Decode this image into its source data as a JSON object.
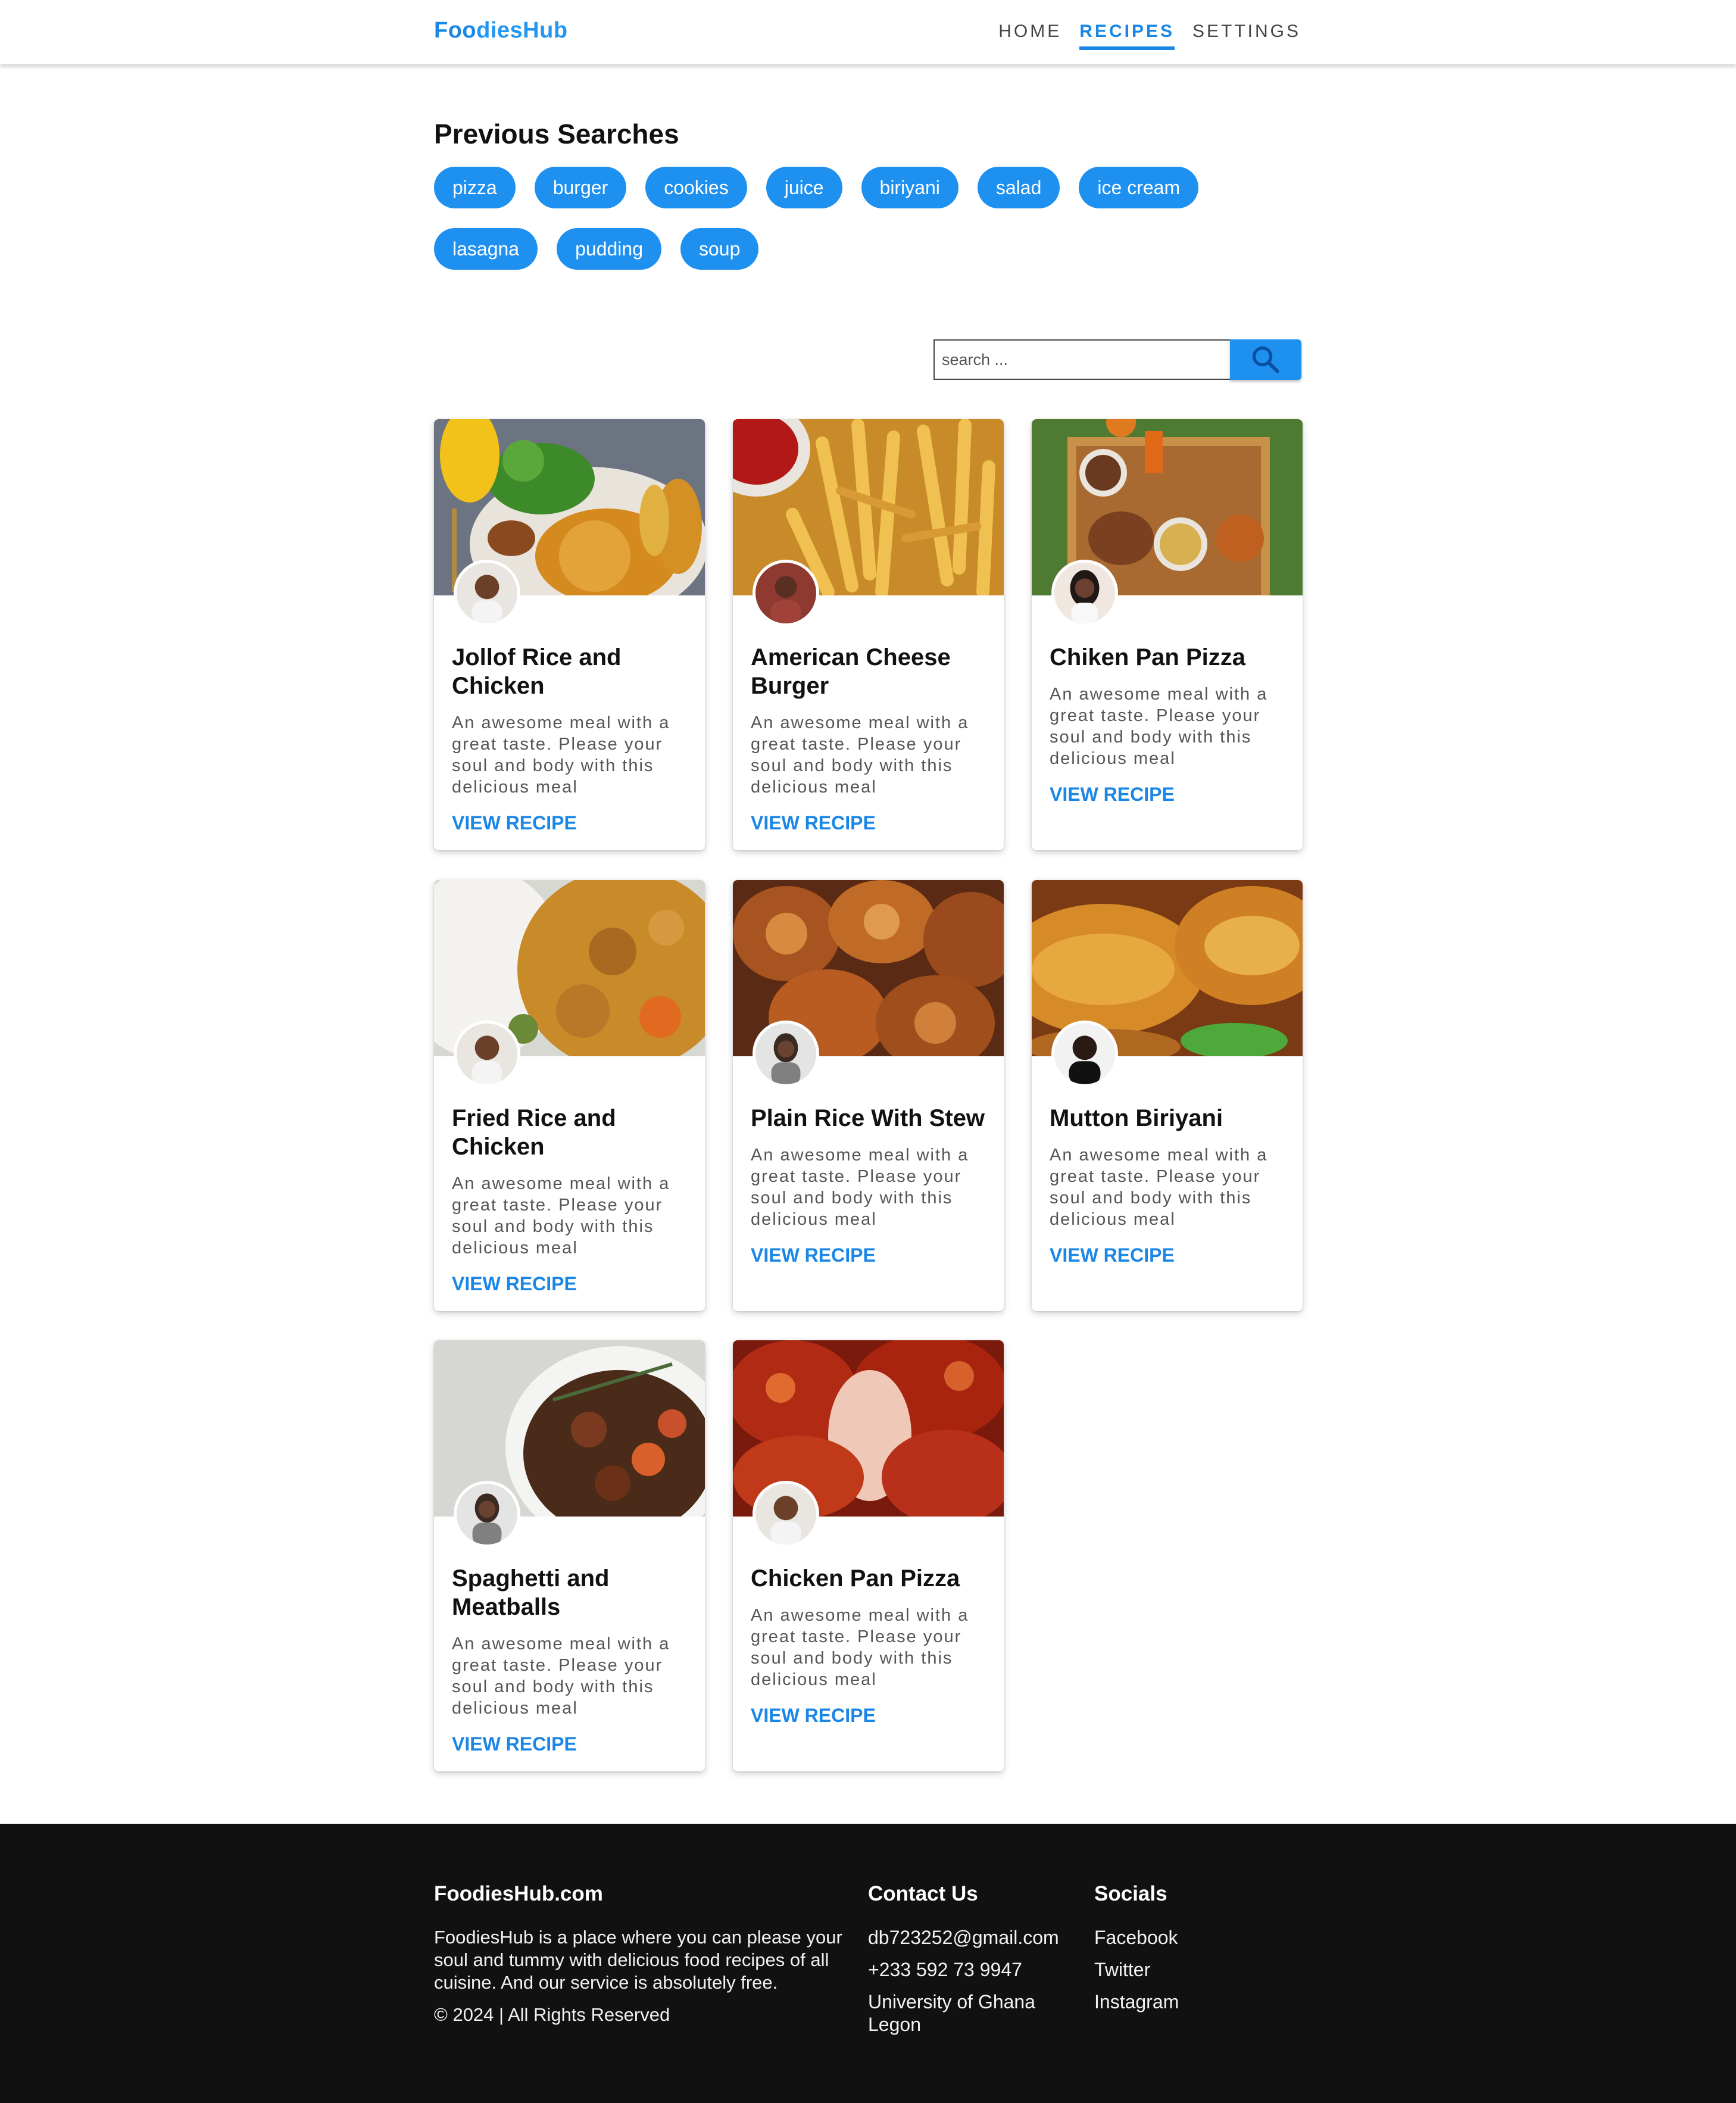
{
  "brand": {
    "logo_part1": "Foo",
    "logo_part2": "diesHub"
  },
  "nav": {
    "items": [
      {
        "label": "HOME",
        "active": false
      },
      {
        "label": "RECIPES",
        "active": true
      },
      {
        "label": "SETTINGS",
        "active": false
      }
    ]
  },
  "previous_searches": {
    "title": "Previous Searches",
    "chips": [
      "pizza",
      "burger",
      "cookies",
      "juice",
      "biriyani",
      "salad",
      "ice cream",
      "lasagna",
      "pudding",
      "soup"
    ]
  },
  "search": {
    "placeholder": "search ...",
    "value": "",
    "button_icon": "search-icon"
  },
  "recipes": [
    {
      "title": "Jollof Rice and Chicken",
      "description": "An awesome meal with a great taste. Please your soul and body with this delicious meal",
      "link": "VIEW RECIPE",
      "image": "jollof-rice-photo",
      "author": "chef-avatar"
    },
    {
      "title": "American Cheese Burger",
      "description": "An awesome meal with a great taste. Please your soul and body with this delicious meal",
      "link": "VIEW RECIPE",
      "image": "fries-photo",
      "author": "chef-avatar"
    },
    {
      "title": "Chiken Pan Pizza",
      "description": "An awesome meal with a great taste. Please your soul and body with this delicious meal",
      "link": "VIEW RECIPE",
      "image": "platter-photo",
      "author": "chef-avatar"
    },
    {
      "title": "Fried Rice and Chicken",
      "description": "An awesome meal with a great taste. Please your soul and body with this delicious meal",
      "link": "VIEW RECIPE",
      "image": "rice-stew-photo",
      "author": "chef-avatar"
    },
    {
      "title": "Plain Rice With Stew",
      "description": "An awesome meal with a great taste. Please your soul and body with this delicious meal",
      "link": "VIEW RECIPE",
      "image": "fried-chicken-photo",
      "author": "chef-avatar"
    },
    {
      "title": "Mutton Biriyani",
      "description": "An awesome meal with a great taste. Please your soul and body with this delicious meal",
      "link": "VIEW RECIPE",
      "image": "croissant-photo",
      "author": "chef-avatar"
    },
    {
      "title": "Spaghetti and Meatballs",
      "description": "An awesome meal with a great taste. Please your soul and body with this delicious meal",
      "link": "VIEW RECIPE",
      "image": "beef-stew-photo",
      "author": "chef-avatar"
    },
    {
      "title": "Chicken Pan Pizza",
      "description": "An awesome meal with a great taste. Please your soul and body with this delicious meal",
      "link": "VIEW RECIPE",
      "image": "glazed-chicken-photo",
      "author": "chef-avatar"
    }
  ],
  "footer": {
    "about": {
      "title": "FoodiesHub.com",
      "text": "FoodiesHub is a place where you can please your soul and tummy with delicious food recipes of all cuisine. And our service is absolutely free.",
      "copyright": "© 2024 | All Rights Reserved"
    },
    "contact": {
      "title": "Contact Us",
      "email": "db723252@gmail.com",
      "phone": "+233 592 73 9947",
      "address": "University of Ghana Legon"
    },
    "socials": {
      "title": "Socials",
      "links": [
        "Facebook",
        "Twitter",
        "Instagram"
      ]
    }
  },
  "colors": {
    "accent": "#1e90f0",
    "footer_bg": "#111111"
  }
}
